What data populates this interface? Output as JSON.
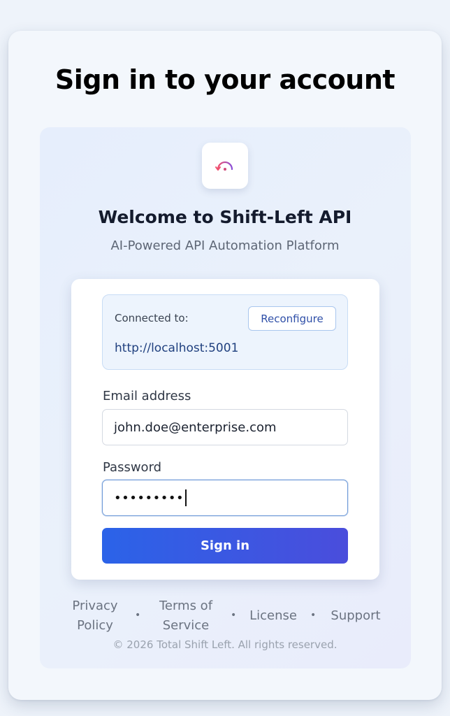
{
  "page": {
    "heading": "Sign in to your account"
  },
  "brand": {
    "logo_icon": "refresh-arc-icon",
    "title": "Welcome to Shift-Left API",
    "subtitle": "AI-Powered API Automation Platform"
  },
  "connection": {
    "label": "Connected to:",
    "url": "http://localhost:5001",
    "reconfigure_label": "Reconfigure"
  },
  "form": {
    "email_label": "Email address",
    "email_value": "john.doe@enterprise.com",
    "password_label": "Password",
    "password_masked": "•••••••••",
    "submit_label": "Sign in"
  },
  "footer": {
    "privacy_line1": "Privacy",
    "privacy_line2": "Policy",
    "terms_line1": "Terms of",
    "terms_line2": "Service",
    "license": "License",
    "support": "Support",
    "separator": "•",
    "copyright": "© 2026 Total Shift Left. All rights reserved."
  },
  "colors": {
    "accent_start": "#2b63e8",
    "accent_end": "#4a4ddc",
    "logo_gradient_start": "#f0506e",
    "logo_gradient_end": "#8a4fd8"
  }
}
